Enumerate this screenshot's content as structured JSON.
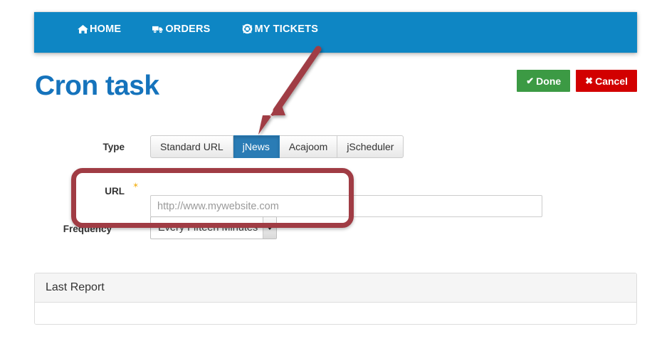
{
  "nav": {
    "items": [
      {
        "label": "HOME",
        "icon": "home-icon"
      },
      {
        "label": "ORDERS",
        "icon": "truck-icon"
      },
      {
        "label": "MY TICKETS",
        "icon": "lifebuoy-icon"
      }
    ]
  },
  "header": {
    "title": "Cron task",
    "title_color": "#1573bc"
  },
  "actions": {
    "done_label": "Done",
    "done_icon": "check-icon",
    "done_color": "#3c9a44",
    "cancel_label": "Cancel",
    "cancel_icon": "times-icon",
    "cancel_color": "#d20000"
  },
  "form": {
    "type": {
      "label": "Type",
      "tabs": [
        {
          "label": "Standard URL",
          "active": false
        },
        {
          "label": "jNews",
          "active": true
        },
        {
          "label": "Acajoom",
          "active": false
        },
        {
          "label": "jScheduler",
          "active": false
        }
      ],
      "active_tab": "jNews",
      "active_color": "#2a7cb5"
    },
    "url": {
      "label": "URL",
      "required_marker": "✶",
      "required_color": "#f4b82e",
      "value": "",
      "placeholder": "http://www.mywebsite.com"
    },
    "frequency": {
      "label": "Frequency",
      "value": "Every Fifteen Minutes",
      "options": [
        "Every Fifteen Minutes"
      ],
      "caret_icon": "caret-down-icon"
    }
  },
  "panel": {
    "title": "Last Report",
    "body_text": ""
  },
  "annotations": {
    "color": "#a03c44",
    "arrow": "arrow-pointing-to-jnews-tab",
    "highlight": "rounded-rect-around-url-field"
  }
}
